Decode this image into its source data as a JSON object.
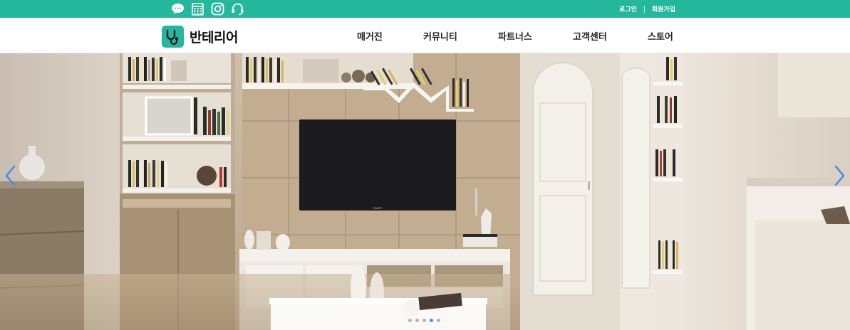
{
  "topbar": {
    "background": "#24b79b",
    "icons": [
      "kakao-chat-icon",
      "calendar-icon",
      "instagram-icon",
      "headset-icon"
    ],
    "login_label": "로그인",
    "signup_label": "회원가입"
  },
  "header": {
    "logo_text": "반테리어",
    "nav": [
      "매거진",
      "커뮤니티",
      "파트너스",
      "고객센터",
      "스토어"
    ]
  },
  "slider": {
    "prev_icon": "chevron-left-icon",
    "next_icon": "chevron-right-icon",
    "slide_count": 5,
    "active_slide": 4,
    "accent": "#4a90e2",
    "tv_brand": "SHARP"
  }
}
